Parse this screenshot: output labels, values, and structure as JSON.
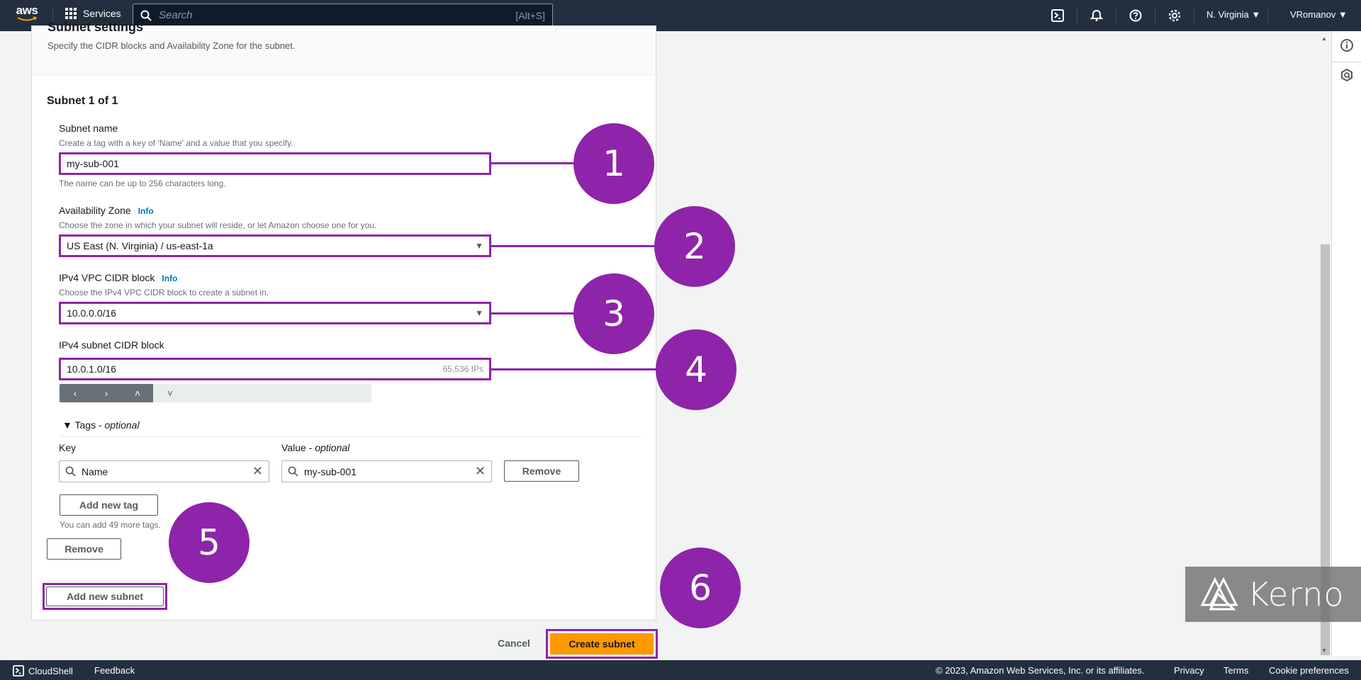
{
  "topnav": {
    "logo_text": "aws",
    "services_label": "Services",
    "search_placeholder": "Search",
    "search_shortcut": "[Alt+S]",
    "icons": [
      "cloudshell-icon",
      "bell-icon",
      "help-icon",
      "gear-icon"
    ],
    "region_label": "N. Virginia ▼",
    "user_label": "VRomanov ▼"
  },
  "section": {
    "title": "Subnet settings",
    "description": "Specify the CIDR blocks and Availability Zone for the subnet."
  },
  "subnet": {
    "title": "Subnet 1 of 1",
    "name_label": "Subnet name",
    "name_hint": "Create a tag with a key of 'Name' and a value that you specify.",
    "name_value": "my-sub-001",
    "name_constraint": "The name can be up to 256 characters long.",
    "az_label": "Availability Zone",
    "az_info": "Info",
    "az_hint": "Choose the zone in which your subnet will reside, or let Amazon choose one for you.",
    "az_value": "US East (N. Virginia) / us-east-1a",
    "vpc_cidr_label": "IPv4 VPC CIDR block",
    "vpc_cidr_info": "Info",
    "vpc_cidr_hint": "Choose the IPv4 VPC CIDR block to create a subnet in.",
    "vpc_cidr_value": "10.0.0.0/16",
    "subnet_cidr_label": "IPv4 subnet CIDR block",
    "subnet_cidr_value": "10.0.1.0/16",
    "subnet_cidr_ips": "65,536 IPs",
    "stepper": {
      "prev": "‹",
      "next": "›",
      "up": "˄",
      "down": "˅"
    }
  },
  "tags": {
    "toggle_label": "Tags - ",
    "toggle_optional": "optional",
    "key_header": "Key",
    "value_header": "Value - ",
    "value_header_optional": "optional",
    "rows": [
      {
        "key": "Name",
        "value": "my-sub-001",
        "remove_label": "Remove"
      }
    ],
    "add_tag_label": "Add new tag",
    "remaining_hint": "You can add 49 more tags."
  },
  "subnet_actions": {
    "remove_label": "Remove",
    "add_subnet_label": "Add new subnet"
  },
  "form_actions": {
    "cancel_label": "Cancel",
    "create_label": "Create subnet"
  },
  "callouts": [
    "1",
    "2",
    "3",
    "4",
    "5",
    "6"
  ],
  "callout_color": "#8e24aa",
  "primary_color": "#ff9900",
  "watermark": {
    "text": "Kerno"
  },
  "footer": {
    "cloudshell_label": "CloudShell",
    "feedback_label": "Feedback",
    "copyright": "© 2023, Amazon Web Services, Inc. or its affiliates.",
    "privacy_label": "Privacy",
    "terms_label": "Terms",
    "cookie_label": "Cookie preferences"
  }
}
